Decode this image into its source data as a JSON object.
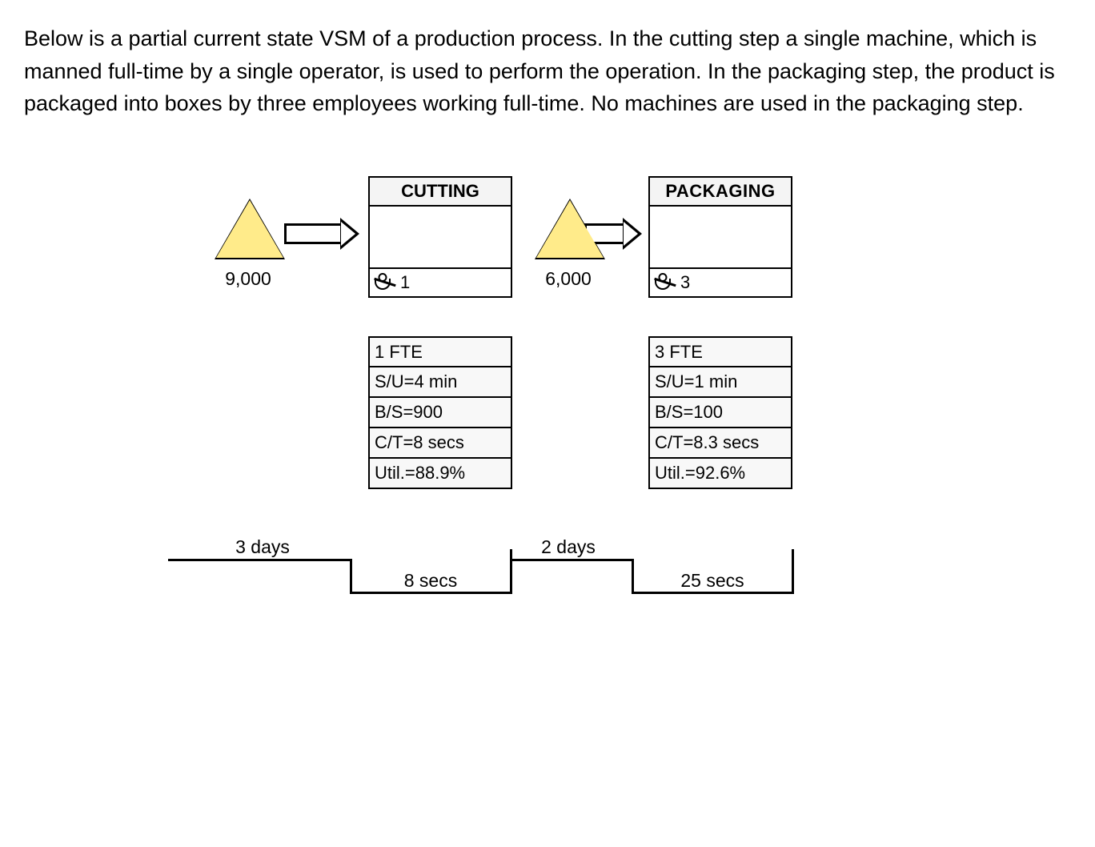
{
  "question_text": "Below is a partial current state VSM of a production process. In the cutting step a single machine, which is manned full-time by a single operator, is used to perform the operation. In the packaging step, the product is packaged into boxes by three employees working full-time. No machines are used in the packaging step.",
  "inventory": {
    "before_cutting": "9,000",
    "before_packaging": "6,000"
  },
  "processes": {
    "cutting": {
      "title": "CUTTING",
      "operators": "1",
      "rows": [
        "1 FTE",
        "S/U=4 min",
        "B/S=900",
        "C/T=8 secs",
        "Util.=88.9%"
      ]
    },
    "packaging": {
      "title": "PACKAGING",
      "operators": "3",
      "rows": [
        "3 FTE",
        "S/U=1 min",
        "B/S=100",
        "C/T=8.3 secs",
        "Util.=92.6%"
      ]
    }
  },
  "timeline": {
    "lead1": "3 days",
    "va1": "8 secs",
    "lead2": "2 days",
    "va2": "25 secs"
  }
}
